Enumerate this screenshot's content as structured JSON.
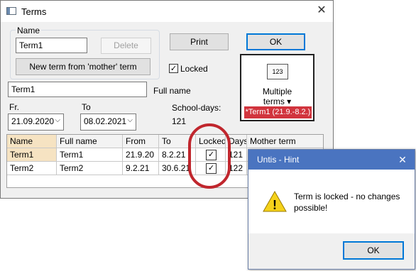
{
  "terms_window": {
    "title": "Terms",
    "close_glyph": "✕",
    "name_group_label": "Name",
    "name_value": "Term1",
    "delete_label": "Delete",
    "new_term_label": "New term from 'mother' term",
    "print_label": "Print",
    "ok_label": "OK",
    "locked_label": "Locked",
    "locked_checked": true,
    "full_name_value": "Term1",
    "full_name_label": "Full name",
    "from_label": "Fr.",
    "from_value": "21.09.2020",
    "to_label": "To",
    "to_value": "08.02.2021",
    "school_days_label": "School-days:",
    "school_days_value": "121",
    "multiple_terms": {
      "icon_text": "123",
      "label_line1": "Multiple",
      "label_line2": "terms ▾",
      "selected_term": "*Term1 (21.9.-8.2.)"
    },
    "grid": {
      "columns": [
        "Name",
        "Full name",
        "From",
        "To",
        "Locked",
        "Days",
        "Mother term"
      ],
      "rows": [
        {
          "name": "Term1",
          "full_name": "Term1",
          "from": "21.9.20",
          "to": "8.2.21",
          "locked": "✓",
          "days": "121"
        },
        {
          "name": "Term2",
          "full_name": "Term2",
          "from": "9.2.21",
          "to": "30.6.21",
          "locked": "✓",
          "days": "122"
        }
      ]
    }
  },
  "hint_dialog": {
    "title": "Untis - Hint",
    "close_glyph": "✕",
    "message": "Term is locked - no changes possible!",
    "ok_label": "OK",
    "warning_glyph": "!"
  },
  "colors": {
    "highlight_ring": "#c0262d",
    "selected_term_bg": "#d1343d",
    "hint_titlebar": "#4a74c0",
    "selected_row": "#f6e3c2"
  }
}
